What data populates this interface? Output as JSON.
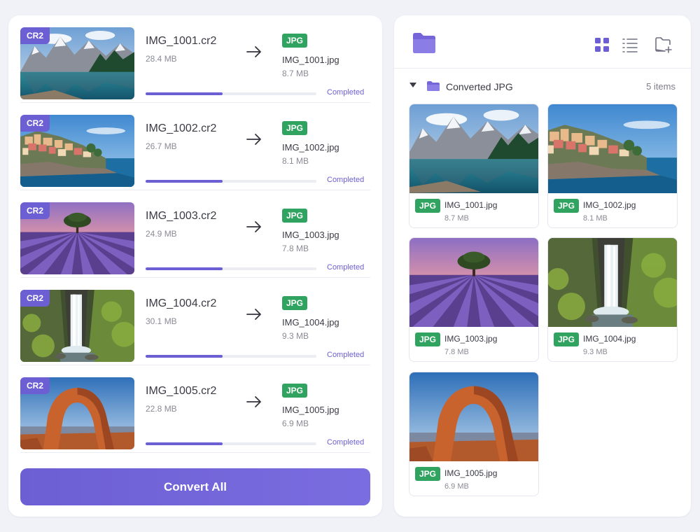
{
  "conversions": [
    {
      "badge": "CR2",
      "source_name": "IMG_1001.cr2",
      "source_size": "28.4 MB",
      "output_format": "JPG",
      "output_name": "IMG_1001.jpg",
      "output_size": "8.7 MB",
      "status": "Completed",
      "progress": 0.45,
      "scene": "mountain-lake"
    },
    {
      "badge": "CR2",
      "source_name": "IMG_1002.cr2",
      "source_size": "26.7 MB",
      "output_format": "JPG",
      "output_name": "IMG_1002.jpg",
      "output_size": "8.1 MB",
      "status": "Completed",
      "progress": 0.45,
      "scene": "coastal-village"
    },
    {
      "badge": "CR2",
      "source_name": "IMG_1003.cr2",
      "source_size": "24.9 MB",
      "output_format": "JPG",
      "output_name": "IMG_1003.jpg",
      "output_size": "7.8 MB",
      "status": "Completed",
      "progress": 0.45,
      "scene": "lavender-field"
    },
    {
      "badge": "CR2",
      "source_name": "IMG_1004.cr2",
      "source_size": "30.1 MB",
      "output_format": "JPG",
      "output_name": "IMG_1004.jpg",
      "output_size": "9.3 MB",
      "status": "Completed",
      "progress": 0.45,
      "scene": "waterfall"
    },
    {
      "badge": "CR2",
      "source_name": "IMG_1005.cr2",
      "source_size": "22.8 MB",
      "output_format": "JPG",
      "output_name": "IMG_1005.jpg",
      "output_size": "6.9 MB",
      "status": "Completed",
      "progress": 0.45,
      "scene": "rock-arch"
    }
  ],
  "convert_all_label": "Convert All",
  "right_panel": {
    "header_icons": [
      "folder-icon",
      "grid-view-icon",
      "list-view-icon",
      "new-folder-icon"
    ],
    "folder_name": "Converted JPG",
    "item_count": "5 items",
    "files": [
      {
        "format": "JPG",
        "name": "IMG_1001.jpg",
        "size": "8.7 MB",
        "scene": "mountain-lake"
      },
      {
        "format": "JPG",
        "name": "IMG_1002.jpg",
        "size": "8.1 MB",
        "scene": "coastal-village"
      },
      {
        "format": "JPG",
        "name": "IMG_1003.jpg",
        "size": "7.8 MB",
        "scene": "lavender-field"
      },
      {
        "format": "JPG",
        "name": "IMG_1004.jpg",
        "size": "9.3 MB",
        "scene": "waterfall"
      },
      {
        "format": "JPG",
        "name": "IMG_1005.jpg",
        "size": "6.9 MB",
        "scene": "rock-arch"
      }
    ]
  },
  "colors": {
    "accent": "#6c5fd3",
    "jpg_badge": "#2fa35f",
    "background": "#f1f2f8"
  }
}
